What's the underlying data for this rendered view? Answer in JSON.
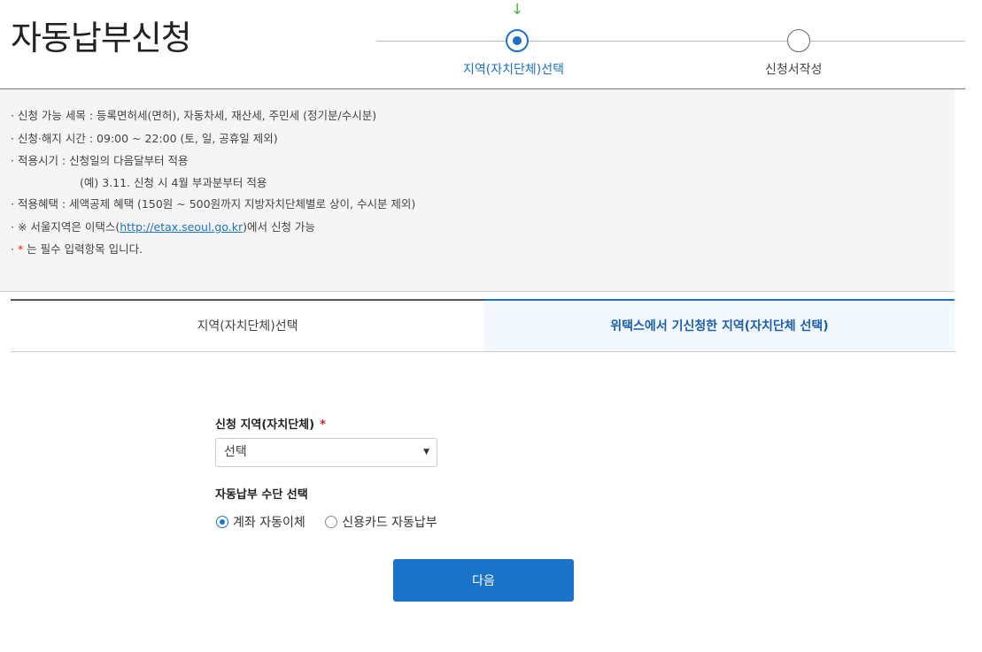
{
  "page": {
    "title": "자동납부신청"
  },
  "stepper": {
    "arrow": "↓",
    "steps": [
      {
        "label": "지역(자치단체)선택",
        "state": "active"
      },
      {
        "label": "신청서작성",
        "state": "inactive"
      }
    ]
  },
  "info": {
    "line1": "· 신청 가능 세목 : 등록면허세(면허), 자동차세, 재산세, 주민세  (정기분/수시분)",
    "line2": "· 신청·해지 시간 : 09:00 ~ 22:00 (토, 일, 공휴일 제외)",
    "line3": "· 적용시기 : 신청일의 다음달부터 적용",
    "line4": "(예) 3.11. 신청 시 4월 부과분부터 적용",
    "line5": "· 적용혜택 : 세액공제 혜택 (150원 ~ 500원까지 지방자치단체별로 상이, 수시분 제외)",
    "line6_prefix": "· ※ 서울지역은 이택스(",
    "line6_link": "http://etax.seoul.go.kr",
    "line6_suffix": ")에서 신청 가능",
    "line7_prefix": "·  ",
    "line7_star": "*",
    "line7_suffix": " 는 필수 입력항목 입니다."
  },
  "tabs": {
    "left": "지역(자치단체)선택",
    "right": "위택스에서 기신청한 지역(자치단체 선택)"
  },
  "form": {
    "region_label": "신청 지역(자치단체)",
    "required_star": "*",
    "region_select": "선택",
    "caret": "▼",
    "method_label": "자동납부 수단 선택",
    "options": [
      {
        "label": "계좌 자동이체",
        "checked": true
      },
      {
        "label": "신용카드 자동납부",
        "checked": false
      }
    ],
    "next_button": "다음"
  },
  "colors": {
    "accent": "#1a73c9",
    "required": "#e02020",
    "step_arrow": "#4caf50"
  }
}
